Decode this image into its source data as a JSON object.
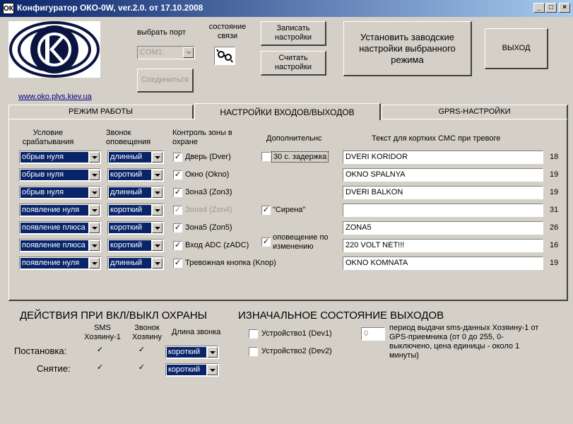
{
  "window": {
    "title": "Конфигуратор ОКО-0W, ver.2.0. от 17.10.2008",
    "app_icon": "ОК",
    "min": "_",
    "max": "□",
    "close": "×"
  },
  "port": {
    "label": "выбрать порт",
    "value": "COM1:",
    "connect": "Соединиться",
    "status_label": "состояние связи"
  },
  "buttons": {
    "write": "Записать настройки",
    "read": "Считать настройки",
    "factory": "Установить заводские настройки выбранного режима",
    "exit": "ВЫХОД"
  },
  "link": "www.oko.plys.kiev.ua",
  "tabs": [
    "РЕЖИМ РАБОТЫ",
    "НАСТРОЙКИ ВХОДОВ/ВЫХОДОВ",
    "GPRS-НАСТРОЙКИ"
  ],
  "columns": {
    "condition": "Условие срабатывания",
    "call": "Звонок оповещения",
    "zone": "Контроль зоны в охране",
    "extra": "Дополнительнс",
    "sms_text": "Текст для кортких СМС при тревоге"
  },
  "rows": [
    {
      "condition": "обрыв нуля",
      "call": "длинный",
      "zone": "Дверь (Dver)",
      "zone_enabled": true,
      "text": "DVERI KORIDOR",
      "count": "18"
    },
    {
      "condition": "обрыв нуля",
      "call": "короткий",
      "zone": "Окно  (Okno)",
      "zone_enabled": true,
      "text": "OKNO SPALNYA",
      "count": "19"
    },
    {
      "condition": "обрыв нуля",
      "call": "длинный",
      "zone": "Зона3 (Zon3)",
      "zone_enabled": true,
      "text": "DVERI BALKON",
      "count": "19"
    },
    {
      "condition": "появление нуля",
      "call": "короткий",
      "zone": "Зона4 (Zon4)",
      "zone_enabled": false,
      "text": "",
      "count": "31"
    },
    {
      "condition": "появление плюса",
      "call": "короткий",
      "zone": "Зона5 (Zon5)",
      "zone_enabled": true,
      "text": "ZONA5",
      "count": "26"
    },
    {
      "condition": "появление плюса",
      "call": "короткий",
      "zone": "Вход ADC (zADC)",
      "zone_enabled": true,
      "text": "220 VOLT NET!!!",
      "count": "16"
    },
    {
      "condition": "появление нуля",
      "call": "длинный",
      "zone": "Тревожная кнопка (Knop)",
      "zone_enabled": true,
      "text": "OKNO KOMNATA",
      "count": "19"
    }
  ],
  "extra": {
    "delay": "30 с. задержка",
    "siren": "\"Сирена\"",
    "notify": "оповещение по изменению"
  },
  "actions": {
    "title": "ДЕЙСТВИЯ ПРИ ВКЛ/ВЫКЛ ОХРАНЫ",
    "col_sms": "SMS Хозяину-1",
    "col_call": "Звонок Хозяину",
    "col_len": "Длина звонка",
    "arm": "Постановка:",
    "disarm": "Снятие:",
    "arm_len": "короткий",
    "disarm_len": "короткий"
  },
  "outputs": {
    "title": "ИЗНАЧАЛЬНОЕ СОСТОЯНИЕ ВЫХОДОВ",
    "dev1": "Устройство1 (Dev1)",
    "dev2": "Устройство2 (Dev2)",
    "gps_value": "0",
    "gps_text": "период выдачи sms-данных Хозяину-1 от GPS-приемника (от 0 до 255, 0-выключено, цена единицы - около 1 минуты)"
  }
}
